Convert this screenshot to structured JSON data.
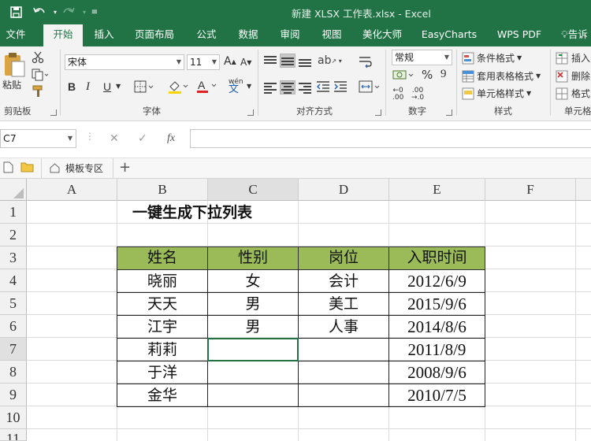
{
  "window": {
    "title": "新建 XLSX 工作表.xlsx - Excel"
  },
  "ribbon_tabs": [
    "文件",
    "开始",
    "插入",
    "页面布局",
    "公式",
    "数据",
    "审阅",
    "视图",
    "美化大师",
    "EasyCharts",
    "WPS PDF",
    "告诉"
  ],
  "active_tab": "开始",
  "ribbon": {
    "clipboard": {
      "paste_label": "粘贴",
      "group_label": "剪贴板"
    },
    "font": {
      "font_name": "宋体",
      "font_size": "11",
      "group_label": "字体",
      "bold": "B",
      "italic": "I",
      "underline": "U",
      "phonetic": "wén"
    },
    "alignment": {
      "group_label": "对齐方式"
    },
    "number": {
      "format": "常规",
      "group_label": "数字",
      "percent": "%",
      "comma": "9"
    },
    "styles": {
      "conditional_format": "条件格式",
      "table_format": "套用表格格式",
      "cell_style": "单元格样式",
      "group_label": "样式"
    },
    "cells": {
      "insert": "插入",
      "delete": "删除",
      "format": "格式",
      "group_label": "单元格"
    }
  },
  "formula_bar": {
    "name_box": "C7",
    "fx": "fx",
    "formula": ""
  },
  "doc_tabs": {
    "template_label": "模板专区",
    "add": "+"
  },
  "sheet": {
    "columns": [
      "A",
      "B",
      "C",
      "D",
      "E",
      "F"
    ],
    "active_column": "C",
    "rows": [
      "1",
      "2",
      "3",
      "4",
      "5",
      "6",
      "7",
      "8",
      "9",
      "10",
      "11"
    ],
    "active_row": "7",
    "title": "一键生成下拉列表",
    "table_header": [
      "姓名",
      "性别",
      "岗位",
      "入职时间"
    ],
    "table_rows": [
      [
        "晓丽",
        "女",
        "会计",
        "2012/6/9"
      ],
      [
        "天天",
        "男",
        "美工",
        "2015/9/6"
      ],
      [
        "江宇",
        "男",
        "人事",
        "2014/8/6"
      ],
      [
        "莉莉",
        "",
        "",
        "2011/8/9"
      ],
      [
        "于洋",
        "",
        "",
        "2008/9/6"
      ],
      [
        "金华",
        "",
        "",
        "2010/7/5"
      ]
    ],
    "header_color": "#9bbb59"
  },
  "colors": {
    "accent": "#217346"
  }
}
